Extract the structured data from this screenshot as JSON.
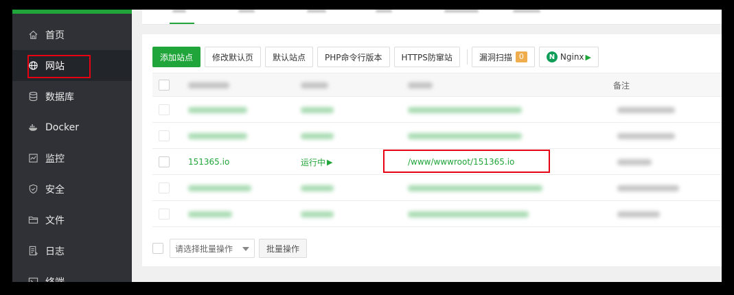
{
  "sidebar": {
    "items": [
      {
        "label": "首页",
        "icon": "home-icon",
        "active": false
      },
      {
        "label": "网站",
        "icon": "globe-icon",
        "active": true
      },
      {
        "label": "数据库",
        "icon": "database-icon",
        "active": false
      },
      {
        "label": "Docker",
        "icon": "docker-icon",
        "active": false
      },
      {
        "label": "监控",
        "icon": "monitor-icon",
        "active": false
      },
      {
        "label": "安全",
        "icon": "shield-icon",
        "active": false
      },
      {
        "label": "文件",
        "icon": "folder-icon",
        "active": false
      },
      {
        "label": "日志",
        "icon": "log-icon",
        "active": false
      },
      {
        "label": "终端",
        "icon": "terminal-icon",
        "active": false
      }
    ]
  },
  "toolbar": {
    "add_site": "添加站点",
    "edit_default_page": "修改默认页",
    "default_site": "默认站点",
    "php_cli_version": "PHP命令行版本",
    "https_firewall": "HTTPS防窜站",
    "vuln_scan": "漏洞扫描",
    "vuln_count": "0",
    "nginx": "Nginx"
  },
  "table": {
    "headers": {
      "remark": "备注"
    },
    "highlight_row": {
      "site": "151365.io",
      "status": "运行中",
      "path": "/www/wwwroot/151365.io"
    }
  },
  "footer": {
    "batch_placeholder": "请选择批量操作",
    "batch_button": "批量操作"
  },
  "colors": {
    "accent": "#20a53a",
    "sidebar_bg": "#2f3136",
    "annotation": "#e60012",
    "badge": "#f0ad4e"
  }
}
